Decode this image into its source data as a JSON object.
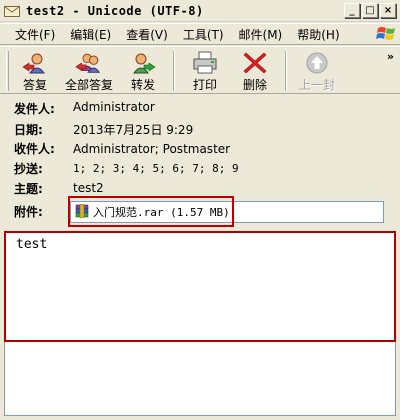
{
  "window": {
    "title": "test2 - Unicode (UTF-8)",
    "min_glyph": "_",
    "max_glyph": "□",
    "close_glyph": "×"
  },
  "menu": [
    "文件(F)",
    "编辑(E)",
    "查看(V)",
    "工具(T)",
    "邮件(M)",
    "帮助(H)"
  ],
  "toolbar": {
    "reply": "答复",
    "reply_all": "全部答复",
    "forward": "转发",
    "print": "打印",
    "delete": "删除",
    "previous": "上一封",
    "more": "»"
  },
  "header": {
    "from_label": "发件人:",
    "from_value": "Administrator",
    "date_label": "日期:",
    "date_value": "2013年7月25日 9:29",
    "to_label": "收件人:",
    "to_value": "Administrator; Postmaster",
    "cc_label": "抄送:",
    "cc_value": "1; 2; 3; 4; 5; 6; 7; 8; 9",
    "subject_label": "主题:",
    "subject_value": "test2",
    "attach_label": "附件:",
    "attach_value": "入门规范.rar (1.57 MB)"
  },
  "body": {
    "text": "test"
  },
  "colors": {
    "highlight_red": "#c00000",
    "chrome": "#ece9d8"
  }
}
